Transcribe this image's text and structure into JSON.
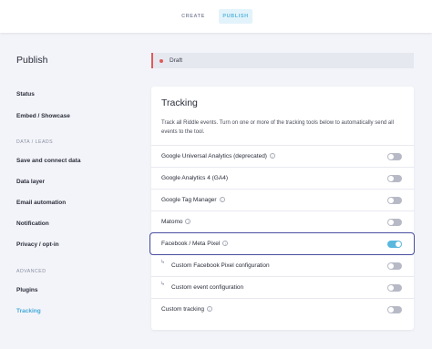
{
  "header": {
    "tabs": [
      {
        "label": "CREATE"
      },
      {
        "label": "PUBLISH"
      }
    ]
  },
  "sidebar": {
    "title": "Publish",
    "items": [
      {
        "label": "Status"
      },
      {
        "label": "Embed / Showcase"
      },
      {
        "label": "DATA / LEADS"
      },
      {
        "label": "Save and connect data"
      },
      {
        "label": "Data layer"
      },
      {
        "label": "Email automation"
      },
      {
        "label": "Notification"
      },
      {
        "label": "Privacy / opt-in"
      },
      {
        "label": "ADVANCED"
      },
      {
        "label": "Plugins"
      },
      {
        "label": "Tracking"
      }
    ]
  },
  "status": {
    "label": "Draft",
    "color": "#e05a5a"
  },
  "tracking": {
    "title": "Tracking",
    "description": "Track all Riddle events. Turn on one or more of the tracking tools below to automatically send all events to the tool.",
    "rows": [
      {
        "label": "Google Universal Analytics (deprecated)",
        "info": "i",
        "enabled": false
      },
      {
        "label": "Google Analytics 4 (GA4)",
        "enabled": false
      },
      {
        "label": "Google Tag Manager",
        "info": "i",
        "enabled": false
      },
      {
        "label": "Matomo",
        "info": "i",
        "enabled": false
      },
      {
        "label": "Facebook / Meta Pixel",
        "info": "i",
        "enabled": true
      },
      {
        "label": "Custom Facebook Pixel configuration",
        "arrow": "↳",
        "enabled": false
      },
      {
        "label": "Custom event configuration",
        "arrow": "↳",
        "enabled": false
      },
      {
        "label": "Custom tracking",
        "info": "i",
        "enabled": false
      }
    ]
  },
  "colors": {
    "accent": "#5ab8df",
    "highlight_border": "#4a4fa0"
  }
}
